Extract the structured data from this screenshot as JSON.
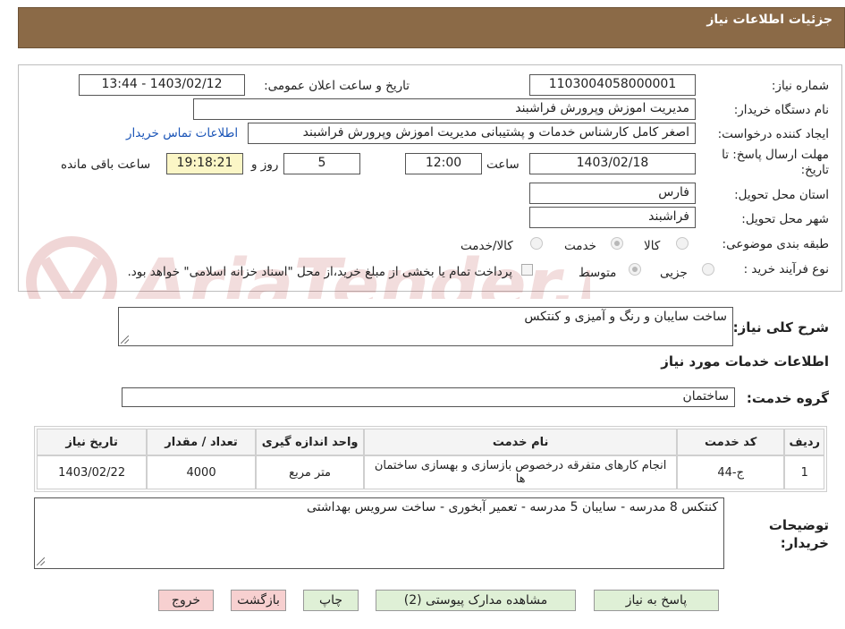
{
  "header": {
    "title": "جزئیات اطلاعات نیاز"
  },
  "form": {
    "need_number": {
      "label": "شماره نیاز:",
      "value": "1103004058000001"
    },
    "announce_datetime": {
      "label": "تاریخ و ساعت اعلان عمومی:",
      "value": "1403/02/12 - 13:44"
    },
    "buyer_org": {
      "label": "نام دستگاه خریدار:",
      "value": "مدیریت اموزش وپرورش فراشبند"
    },
    "requester": {
      "label": "ایجاد کننده درخواست:",
      "value": "اصغر کامل کارشناس خدمات و پشتیبانی مدیریت اموزش وپرورش فراشبند",
      "contact_link": "اطلاعات تماس خریدار"
    },
    "deadline": {
      "label": "مهلت ارسال پاسخ: تا تاریخ:",
      "date": "1403/02/18",
      "time_label": "ساعت",
      "time": "12:00",
      "days": "5",
      "days_label": "روز و",
      "remaining": "19:18:21",
      "remaining_label": "ساعت باقی مانده"
    },
    "province": {
      "label": "استان محل تحویل:",
      "value": "فارس"
    },
    "city": {
      "label": "شهر محل تحویل:",
      "value": "فراشبند"
    },
    "category": {
      "label": "طبقه بندی موضوعی:",
      "options": [
        "کالا",
        "خدمت",
        "کالا/خدمت"
      ],
      "selected": "خدمت"
    },
    "process": {
      "label": "نوع فرآیند خرید :",
      "options": [
        "جزیی",
        "متوسط"
      ],
      "selected": "متوسط",
      "payment_note": "پرداخت تمام یا بخشی از مبلغ خرید،از محل \"اسناد خزانه اسلامی\" خواهد بود."
    }
  },
  "description": {
    "label": "شرح کلی نیاز:",
    "value": "ساخت سایبان و رنگ و آمیزی  و کنتکس"
  },
  "services_section": {
    "title": "اطلاعات خدمات مورد نیاز"
  },
  "service_group": {
    "label": "گروه خدمت:",
    "value": "ساختمان"
  },
  "table": {
    "headers": [
      "ردیف",
      "کد خدمت",
      "نام خدمت",
      "واحد اندازه گیری",
      "تعداد / مقدار",
      "تاریخ نیاز"
    ],
    "rows": [
      [
        "1",
        "ج-44",
        "انجام کارهای متفرقه درخصوص بازسازی و بهسازی ساختمان ها",
        "متر مربع",
        "4000",
        "1403/02/22"
      ]
    ]
  },
  "buyer_notes": {
    "label": "توضیحات خریدار:",
    "value": "کنتکس 8 مدرسه - سایبان 5 مدرسه - تعمیر آبخوری  -  ساخت سرویس بهداشتی"
  },
  "buttons": {
    "reply": "پاسخ به نیاز",
    "attachments": "مشاهده مدارک پیوستی (2)",
    "print": "چاپ",
    "back": "بازگشت",
    "exit": "خروج"
  },
  "watermark": {
    "text": "AriaTender.neT"
  },
  "colors": {
    "header_bg": "#8b6a47",
    "green_button": "#dff0d6",
    "pink_button": "#f7d0d0",
    "remaining_bg": "#fbf6c6",
    "link": "#1a54b7"
  }
}
